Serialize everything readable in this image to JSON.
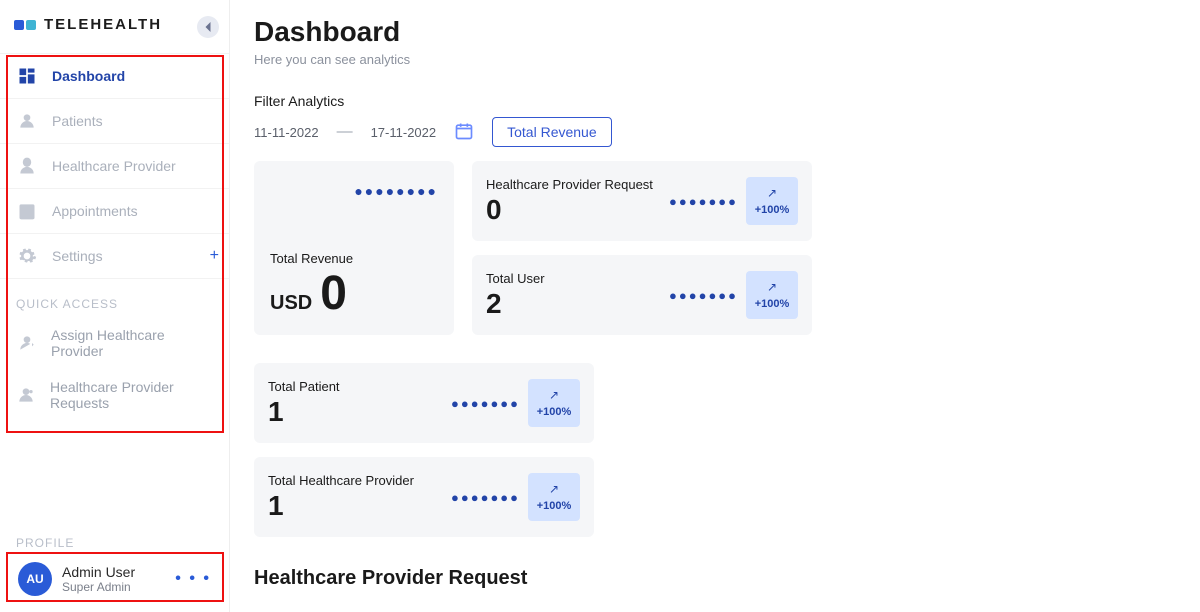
{
  "brand": {
    "title": "TELEHEALTH"
  },
  "sidebar": {
    "items": [
      {
        "label": "Dashboard"
      },
      {
        "label": "Patients"
      },
      {
        "label": "Healthcare Provider"
      },
      {
        "label": "Appointments"
      },
      {
        "label": "Settings"
      }
    ],
    "quick_access_label": "QUICK ACCESS",
    "quick": [
      {
        "label": "Assign Healthcare Provider"
      },
      {
        "label": "Healthcare Provider Requests"
      }
    ]
  },
  "profile": {
    "section_label": "PROFILE",
    "initials": "AU",
    "name": "Admin User",
    "role": "Super Admin"
  },
  "page": {
    "title": "Dashboard",
    "subtitle": "Here you can see analytics"
  },
  "filter": {
    "label": "Filter Analytics",
    "date_from": "11-11-2022",
    "date_to": "17-11-2022",
    "button": "Total Revenue"
  },
  "revenue_card": {
    "label": "Total Revenue",
    "currency": "USD",
    "value": "0"
  },
  "stats": {
    "hpr": {
      "label": "Healthcare Provider Request",
      "value": "0",
      "pct": "+100%"
    },
    "total_user": {
      "label": "Total User",
      "value": "2",
      "pct": "+100%"
    },
    "total_patient": {
      "label": "Total Patient",
      "value": "1",
      "pct": "+100%"
    },
    "total_hp": {
      "label": "Total Healthcare Provider",
      "value": "1",
      "pct": "+100%"
    }
  },
  "section2": {
    "title": "Healthcare Provider Request"
  }
}
